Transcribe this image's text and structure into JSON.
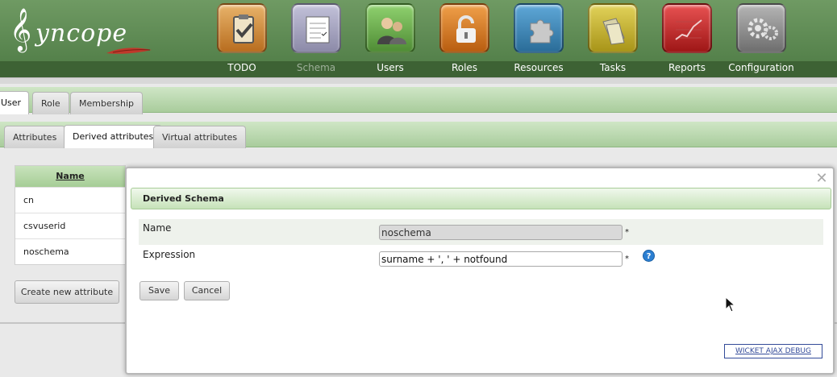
{
  "app": {
    "logo_text": "yncope"
  },
  "menu": [
    {
      "label": "TODO",
      "icon": "clipboard-check-icon",
      "color": "#c98a3a"
    },
    {
      "label": "Schema",
      "icon": "schema-form-icon",
      "color": "#9c9ab8",
      "active": true
    },
    {
      "label": "Users",
      "icon": "users-icon",
      "color": "#6aa84f"
    },
    {
      "label": "Roles",
      "icon": "padlock-icon",
      "color": "#d97d1e"
    },
    {
      "label": "Resources",
      "icon": "puzzle-icon",
      "color": "#3d86b8"
    },
    {
      "label": "Tasks",
      "icon": "folders-icon",
      "color": "#c9b52c"
    },
    {
      "label": "Reports",
      "icon": "report-chart-icon",
      "color": "#c92b2b"
    },
    {
      "label": "Configuration",
      "icon": "gears-icon",
      "color": "#8a8a8a"
    }
  ],
  "tabs_primary": [
    "User",
    "Role",
    "Membership"
  ],
  "tabs_secondary": [
    "Attributes",
    "Derived attributes",
    "Virtual attributes"
  ],
  "grid": {
    "header": "Name",
    "rows": [
      "cn",
      "csvuserid",
      "noschema"
    ]
  },
  "create_button": "Create new attribute",
  "modal": {
    "title": "Derived Schema",
    "close_glyph": "✕",
    "name_label": "Name",
    "name_value": "noschema",
    "expression_label": "Expression",
    "expression_value": "surname + ', ' + notfound",
    "required_mark": "*",
    "help_glyph": "?",
    "save_label": "Save",
    "cancel_label": "Cancel",
    "debug_link": "WICKET AJAX DEBUG"
  }
}
